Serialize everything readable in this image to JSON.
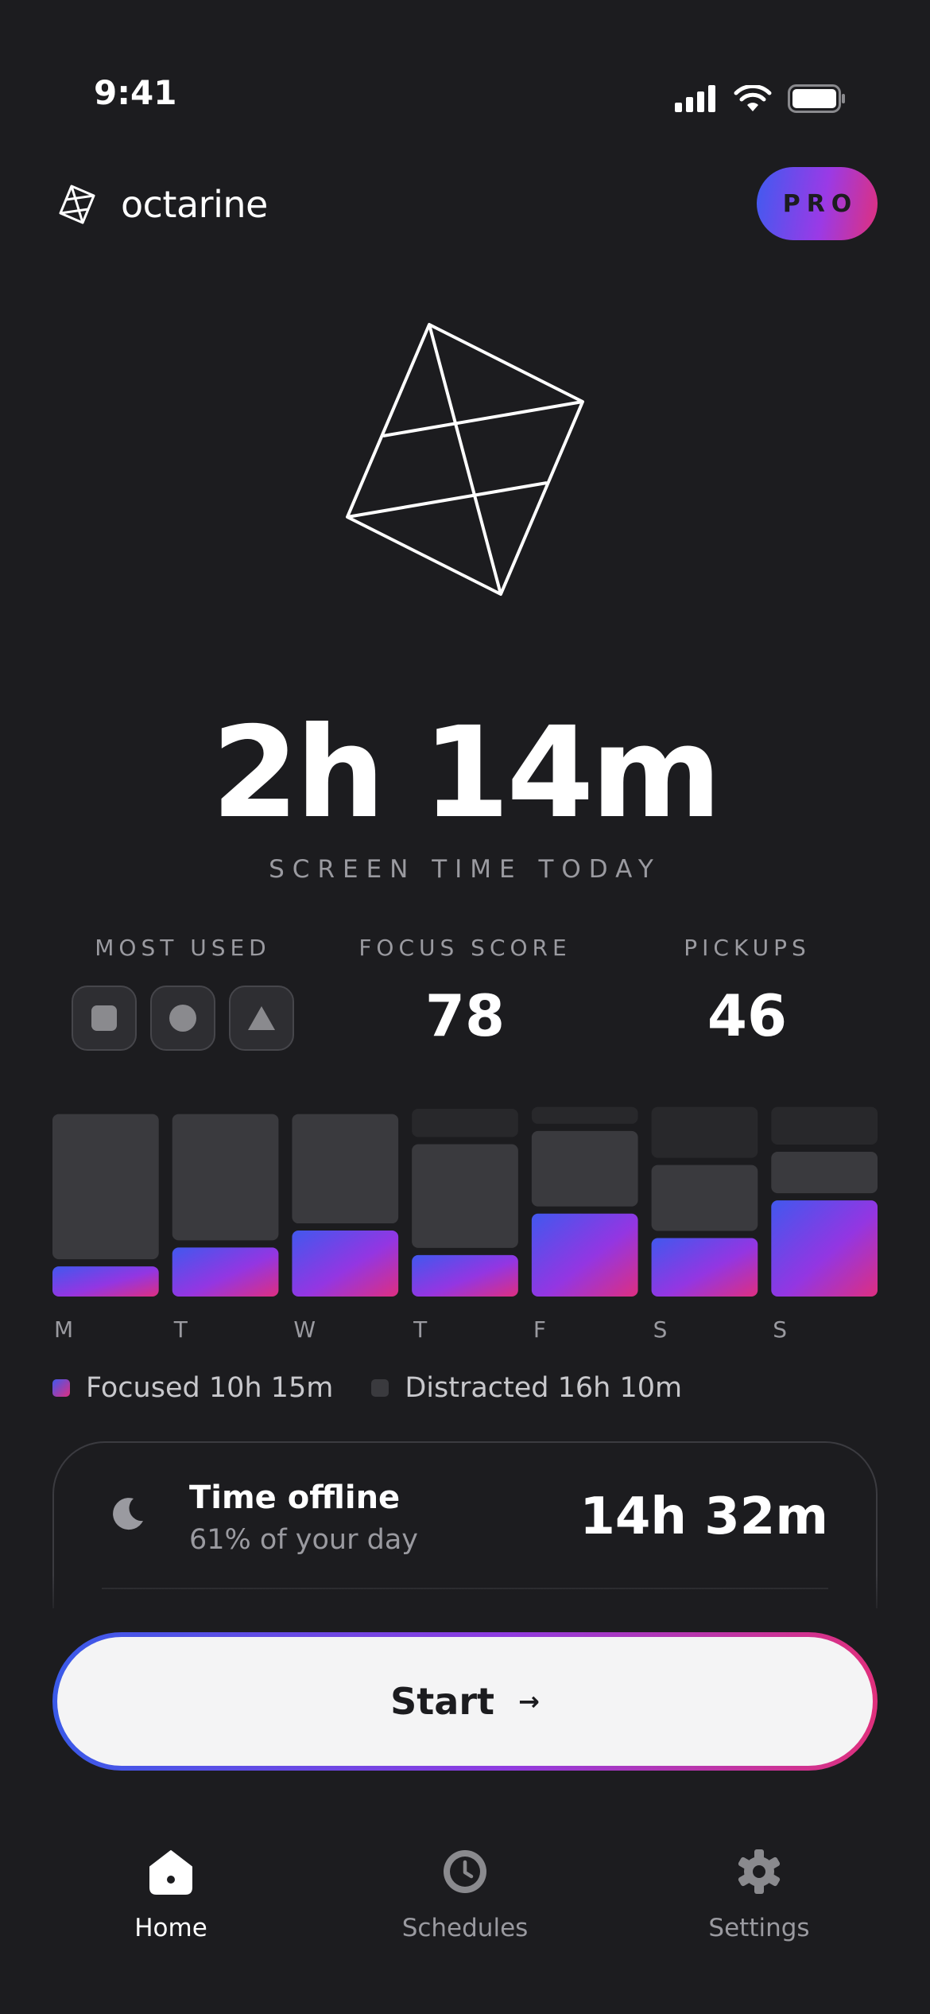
{
  "status_bar": {
    "time": "9:41"
  },
  "header": {
    "brand": "octarine",
    "pro_label": "PRO"
  },
  "summary": {
    "total_time": "2h 14m",
    "label": "SCREEN TIME TODAY"
  },
  "stats": {
    "most_used_label": "MOST USED",
    "focus_score_label": "FOCUS SCORE",
    "focus_score": "78",
    "pickups_label": "PICKUPS",
    "pickups": "46",
    "most_used_icons": [
      "square-icon",
      "circle-icon",
      "triangle-icon"
    ]
  },
  "chart_data": {
    "type": "bar",
    "stacked": true,
    "categories": [
      "M",
      "T",
      "W",
      "T",
      "F",
      "S",
      "S"
    ],
    "series": [
      {
        "name": "Focused",
        "color": "gradient",
        "values": [
          0.16,
          0.26,
          0.35,
          0.22,
          0.44,
          0.31,
          0.51
        ]
      },
      {
        "name": "Distracted",
        "color": "#3a3a3e",
        "values": [
          0.77,
          0.67,
          0.58,
          0.55,
          0.4,
          0.35,
          0.22
        ]
      },
      {
        "name": "",
        "color": "#28282b",
        "values": [
          0,
          0,
          0,
          0.15,
          0.09,
          0.27,
          0.2
        ]
      }
    ]
  },
  "legend": {
    "focused": "Focused 10h 15m",
    "distracted": "Distracted 16h 10m",
    "focused_color": "#8b3ce6",
    "distracted_color": "#3a3a3e"
  },
  "offline": {
    "title": "Time offline",
    "subtitle": "61% of your day",
    "value": "14h 32m"
  },
  "start_button": {
    "label": "Start",
    "arrow": "→"
  },
  "tabbar": {
    "items": [
      {
        "label": "Home",
        "icon": "home-icon",
        "active": true
      },
      {
        "label": "Schedules",
        "icon": "clock-icon",
        "active": false
      },
      {
        "label": "Settings",
        "icon": "gear-icon",
        "active": false
      }
    ]
  }
}
